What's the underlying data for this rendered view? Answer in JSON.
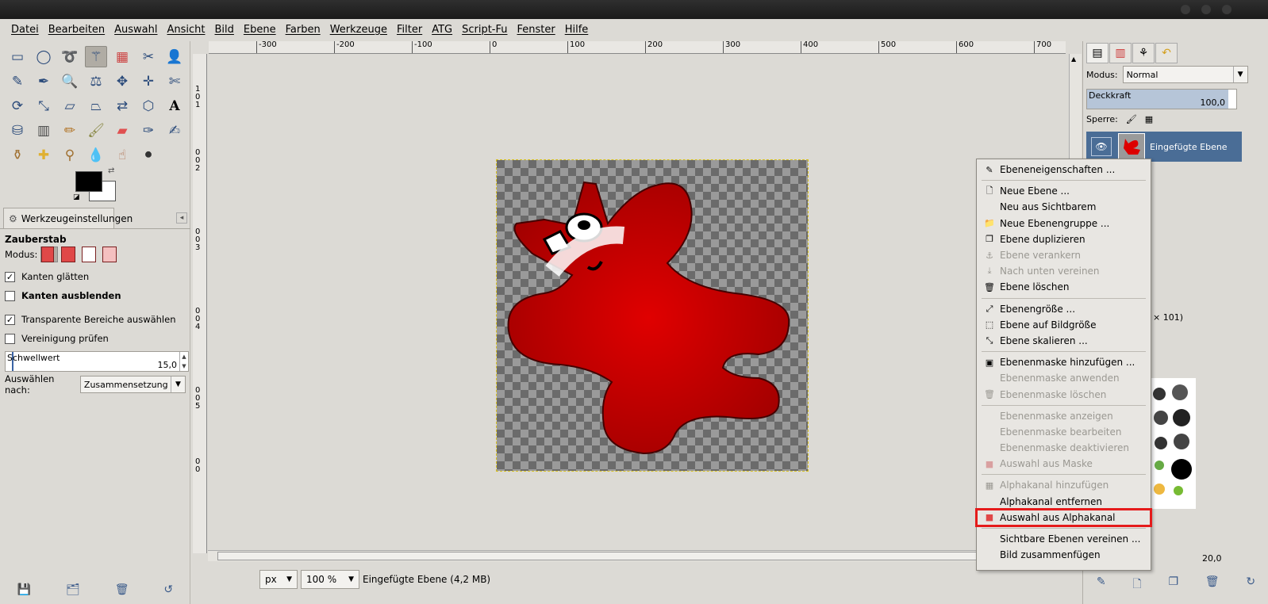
{
  "menubar": [
    "Datei",
    "Bearbeiten",
    "Auswahl",
    "Ansicht",
    "Bild",
    "Ebene",
    "Farben",
    "Werkzeuge",
    "Filter",
    "ATG",
    "Script-Fu",
    "Fenster",
    "Hilfe"
  ],
  "ruler_top": [
    "-300",
    "-200",
    "-100",
    "0",
    "100",
    "200",
    "300",
    "400",
    "500",
    "600",
    "700"
  ],
  "ruler_left": [
    "1",
    "0",
    "1",
    "0",
    "0",
    "2",
    "0",
    "0",
    "3",
    "0",
    "0",
    "4",
    "0",
    "0",
    "5",
    "0",
    "0"
  ],
  "tool_options": {
    "tab_label": "Werkzeugeinstellungen",
    "title": "Zauberstab",
    "mode_label": "Modus:",
    "antialias": "Kanten glätten",
    "feather": "Kanten ausblenden",
    "transparent": "Transparente Bereiche auswählen",
    "sample_merged": "Vereinigung prüfen",
    "threshold_label": "Schwellwert",
    "threshold_value": "15,0",
    "select_by_label": "Auswählen nach:",
    "select_by_value": "Zusammensetzung"
  },
  "status": {
    "unit": "px",
    "zoom": "100 %",
    "layer_info": "Eingefügte Ebene (4,2 MB)"
  },
  "dock": {
    "mode_label": "Modus:",
    "mode_value": "Normal",
    "opacity_label": "Deckkraft",
    "opacity_value": "100,0",
    "lock_label": "Sperre:",
    "layer_name": "Eingefügte Ebene",
    "brush_info": "× 101)",
    "spacing_value": "20,0"
  },
  "context_menu": [
    {
      "label": "Ebeneneigenschaften ...",
      "disabled": false,
      "icon": "edit-icon"
    },
    {
      "sep": true
    },
    {
      "label": "Neue Ebene ...",
      "disabled": false,
      "icon": "new-layer-icon"
    },
    {
      "label": "Neu aus Sichtbarem",
      "disabled": false,
      "icon": ""
    },
    {
      "label": "Neue Ebenengruppe ...",
      "disabled": false,
      "icon": "folder-icon"
    },
    {
      "label": "Ebene duplizieren",
      "disabled": false,
      "icon": "duplicate-icon"
    },
    {
      "label": "Ebene verankern",
      "disabled": true,
      "icon": "anchor-icon"
    },
    {
      "label": "Nach unten vereinen",
      "disabled": true,
      "icon": "merge-down-icon"
    },
    {
      "label": "Ebene löschen",
      "disabled": false,
      "icon": "trash-icon"
    },
    {
      "sep": true
    },
    {
      "label": "Ebenengröße ...",
      "disabled": false,
      "icon": "resize-icon"
    },
    {
      "label": "Ebene auf Bildgröße",
      "disabled": false,
      "icon": "fit-icon"
    },
    {
      "label": "Ebene skalieren ...",
      "disabled": false,
      "icon": "scale-icon"
    },
    {
      "sep": true
    },
    {
      "label": "Ebenenmaske hinzufügen ...",
      "disabled": false,
      "icon": "mask-add-icon"
    },
    {
      "label": "Ebenenmaske anwenden",
      "disabled": true,
      "icon": ""
    },
    {
      "label": "Ebenenmaske löschen",
      "disabled": true,
      "icon": "trash-icon"
    },
    {
      "sep": true
    },
    {
      "label": "Ebenenmaske anzeigen",
      "disabled": true,
      "icon": ""
    },
    {
      "label": "Ebenenmaske bearbeiten",
      "disabled": true,
      "icon": ""
    },
    {
      "label": "Ebenenmaske deaktivieren",
      "disabled": true,
      "icon": ""
    },
    {
      "label": "Auswahl aus Maske",
      "disabled": true,
      "icon": "selection-icon"
    },
    {
      "sep": true
    },
    {
      "label": "Alphakanal hinzufügen",
      "disabled": true,
      "icon": "alpha-icon"
    },
    {
      "label": "Alphakanal entfernen",
      "disabled": false,
      "icon": ""
    },
    {
      "label": "Auswahl aus Alphakanal",
      "disabled": false,
      "icon": "selection-icon",
      "highlight": true
    },
    {
      "sep": true
    },
    {
      "label": "Sichtbare Ebenen vereinen ...",
      "disabled": false,
      "icon": ""
    },
    {
      "label": "Bild zusammenfügen",
      "disabled": false,
      "icon": ""
    }
  ],
  "colors": {
    "accent_highlight": "#e51b1b",
    "selected_layer": "#4a6d96",
    "image_red": "#cc0000"
  }
}
